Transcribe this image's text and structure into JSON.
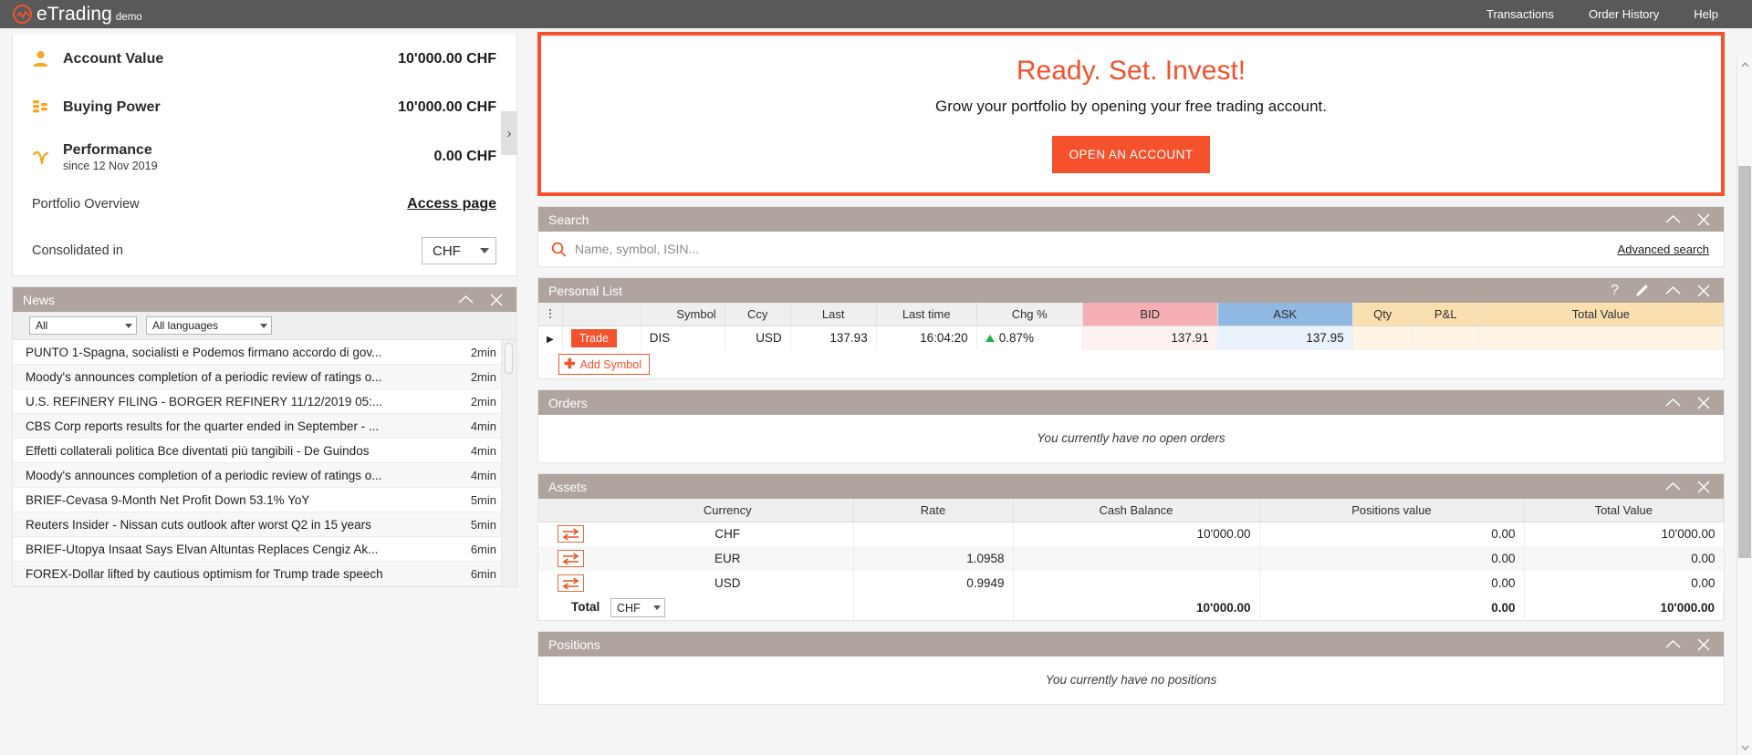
{
  "topbar": {
    "brand_name": "eTrading",
    "brand_sub": "demo",
    "nav": [
      {
        "label": "Transactions"
      },
      {
        "label": "Order History"
      },
      {
        "label": "Help"
      }
    ]
  },
  "account": {
    "rows": [
      {
        "icon": "person-icon",
        "label": "Account Value",
        "sub": "",
        "value": "10'000.00 CHF"
      },
      {
        "icon": "coins-icon",
        "label": "Buying Power",
        "sub": "",
        "value": "10'000.00 CHF"
      },
      {
        "icon": "performance-icon",
        "label": "Performance",
        "sub": "since 12 Nov 2019",
        "value": "0.00 CHF"
      }
    ],
    "portfolio_label": "Portfolio Overview",
    "portfolio_link": "Access page",
    "consolidated_label": "Consolidated in",
    "consolidated_value": "CHF"
  },
  "news": {
    "title": "News",
    "filter_category": "All",
    "filter_language": "All languages",
    "items": [
      {
        "title": "PUNTO 1-Spagna, socialisti e Podemos firmano accordo di gov...",
        "time": "2min"
      },
      {
        "title": "Moody's announces completion of a periodic review of ratings o...",
        "time": "2min"
      },
      {
        "title": "U.S. REFINERY FILING - BORGER REFINERY 11/12/2019 05:...",
        "time": "2min"
      },
      {
        "title": "CBS Corp reports results for the quarter ended in September - ...",
        "time": "4min"
      },
      {
        "title": "Effetti collaterali politica Bce diventati più tangibili - De Guindos",
        "time": "4min"
      },
      {
        "title": "Moody's announces completion of a periodic review of ratings o...",
        "time": "4min"
      },
      {
        "title": "BRIEF-Cevasa 9-Month Net Profit Down 53.1% YoY",
        "time": "5min"
      },
      {
        "title": "Reuters Insider - Nissan cuts outlook after worst Q2 in 15 years",
        "time": "5min"
      },
      {
        "title": "BRIEF-Utopya Insaat Says Elvan Altuntas Replaces Cengiz Ak...",
        "time": "6min"
      },
      {
        "title": "FOREX-Dollar lifted by cautious optimism for Trump trade speech",
        "time": "6min"
      }
    ]
  },
  "banner": {
    "heading": "Ready. Set. Invest!",
    "subtext": "Grow your portfolio by opening your free trading account.",
    "button": "OPEN AN ACCOUNT"
  },
  "search": {
    "title": "Search",
    "placeholder": "Name, symbol, ISIN...",
    "value": "",
    "advanced_link": "Advanced search"
  },
  "personal_list": {
    "title": "Personal List",
    "columns": [
      "",
      "",
      "Symbol",
      "Ccy",
      "Last",
      "Last time",
      "Chg %",
      "BID",
      "ASK",
      "Qty",
      "P&L",
      "Total Value"
    ],
    "rows": [
      {
        "trade_label": "Trade",
        "symbol": "DIS",
        "ccy": "USD",
        "last": "137.93",
        "last_time": "16:04:20",
        "chg_pct": "0.87%",
        "chg_dir": "up",
        "bid": "137.91",
        "ask": "137.95",
        "qty": "",
        "pl": "",
        "total_value": ""
      }
    ],
    "add_symbol_label": "Add Symbol"
  },
  "orders": {
    "title": "Orders",
    "empty_message": "You currently have no open orders"
  },
  "assets": {
    "title": "Assets",
    "columns": [
      "",
      "Currency",
      "Rate",
      "Cash Balance",
      "Positions value",
      "Total Value"
    ],
    "rows": [
      {
        "currency": "CHF",
        "rate": "",
        "cash_balance": "10'000.00",
        "positions_value": "0.00",
        "total_value": "10'000.00"
      },
      {
        "currency": "EUR",
        "rate": "1.0958",
        "cash_balance": "",
        "positions_value": "0.00",
        "total_value": "0.00"
      },
      {
        "currency": "USD",
        "rate": "0.9949",
        "cash_balance": "",
        "positions_value": "0.00",
        "total_value": "0.00"
      }
    ],
    "total_label": "Total",
    "total_currency": "CHF",
    "total_cash_balance": "10'000.00",
    "total_positions_value": "0.00",
    "total_value": "10'000.00"
  },
  "positions": {
    "title": "Positions",
    "empty_message": "You currently have no positions"
  },
  "colors": {
    "brand_orange": "#f4512c",
    "topbar_gray": "#595959",
    "panel_header": "#b0a49f",
    "bid_header": "#f4aeb4",
    "ask_header": "#8fb8e3",
    "amber_header": "#fadfb0",
    "up_green": "#22b14c"
  }
}
